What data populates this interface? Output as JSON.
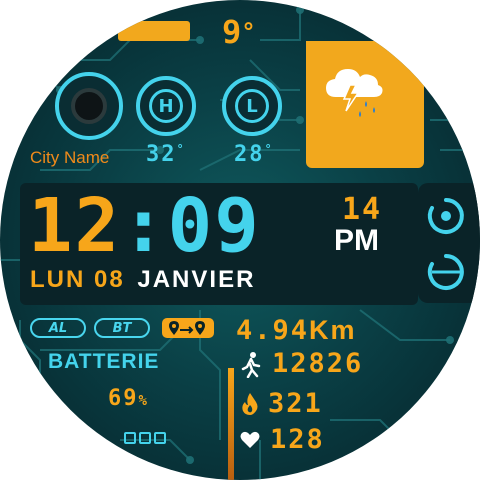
{
  "weather": {
    "temperature": "9",
    "temp_unit": "°",
    "icon": "thunder-rain-cloud-icon"
  },
  "location": {
    "city": "City Name"
  },
  "forecast": {
    "high_letter": "H",
    "low_letter": "L",
    "high_value": "32",
    "low_value": "28",
    "unit": "°"
  },
  "time": {
    "hours": "12",
    "colon": ":",
    "minutes": "09",
    "seconds": "14",
    "ampm": "PM"
  },
  "date": {
    "day": "LUN",
    "date": "08",
    "month": "JANVIER"
  },
  "status": {
    "alarm": "AL",
    "bluetooth": "BT",
    "route_icon": "route-icon"
  },
  "battery": {
    "label": "BATTERIE",
    "value": "69",
    "unit": "%",
    "level": 0.69
  },
  "stats": {
    "distance": "4.94",
    "distance_unit": "Km",
    "steps": "12826",
    "calories": "321",
    "heart_rate": "128"
  },
  "colors": {
    "accent_orange": "#f7a61a",
    "accent_cyan": "#44d3ec",
    "background": "#0a3f45"
  }
}
